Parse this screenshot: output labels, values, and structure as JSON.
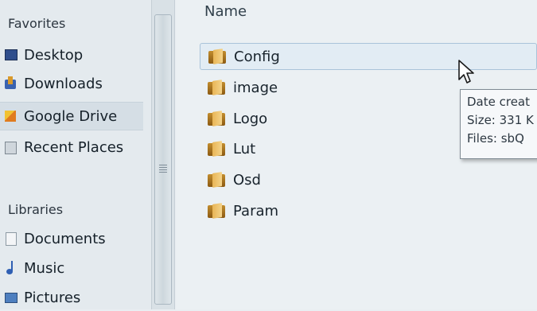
{
  "nav": {
    "favorites_label": "Favorites",
    "favorites": [
      {
        "label": "Desktop",
        "icon": "desktop-icon"
      },
      {
        "label": "Downloads",
        "icon": "downloads-icon"
      },
      {
        "label": "Google Drive",
        "icon": "google-drive-icon",
        "selected": true
      },
      {
        "label": "Recent Places",
        "icon": "recent-places-icon"
      }
    ],
    "libraries_label": "Libraries",
    "libraries": [
      {
        "label": "Documents",
        "icon": "documents-icon"
      },
      {
        "label": "Music",
        "icon": "music-icon"
      },
      {
        "label": "Pictures",
        "icon": "pictures-icon"
      }
    ]
  },
  "main": {
    "column_header": "Name",
    "files": [
      {
        "name": "Config",
        "icon": "folder-icon",
        "hover": true
      },
      {
        "name": "image",
        "icon": "folder-icon"
      },
      {
        "name": "Logo",
        "icon": "folder-icon"
      },
      {
        "name": "Lut",
        "icon": "folder-icon"
      },
      {
        "name": "Osd",
        "icon": "folder-icon"
      },
      {
        "name": "Param",
        "icon": "folder-icon"
      }
    ]
  },
  "tooltip": {
    "line1": "Date creat",
    "line2": "Size: 331 K",
    "line3": "Files: sbQ"
  },
  "colors": {
    "folder": "#d9a23f",
    "hover_border": "#a9c3d9",
    "selection": "#d5dee5"
  }
}
